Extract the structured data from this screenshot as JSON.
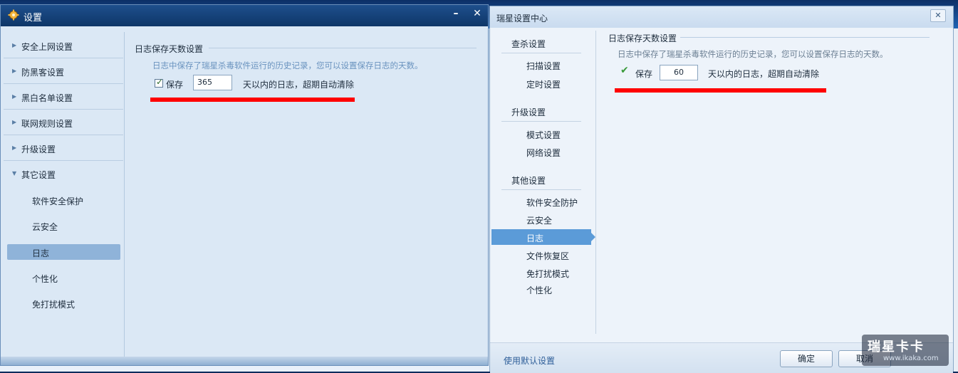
{
  "windowA": {
    "title": "设置",
    "minimize": "–",
    "close": "✕",
    "sidebar": {
      "sections": [
        {
          "label": "安全上网设置"
        },
        {
          "label": "防黑客设置"
        },
        {
          "label": "黑白名单设置"
        },
        {
          "label": "联网规则设置"
        },
        {
          "label": "升级设置"
        },
        {
          "label": "其它设置"
        }
      ],
      "subitems": [
        {
          "label": "软件安全保护"
        },
        {
          "label": "云安全"
        },
        {
          "label": "日志",
          "selected": true
        },
        {
          "label": "个性化"
        },
        {
          "label": "免打扰模式"
        }
      ]
    },
    "content": {
      "section_title": "日志保存天数设置",
      "description": "日志中保存了瑞星杀毒软件运行的历史记录，您可以设置保存日志的天数。",
      "save_label": "保存",
      "save_checked": true,
      "days_value": "365",
      "suffix": "天以内的日志，超期自动清除"
    }
  },
  "windowB": {
    "title": "瑞星设置中心",
    "close": "✕",
    "nav": {
      "group1": {
        "label": "查杀设置",
        "items": [
          {
            "label": "扫描设置"
          },
          {
            "label": "定时设置"
          }
        ]
      },
      "group2": {
        "label": "升级设置",
        "items": [
          {
            "label": "模式设置"
          },
          {
            "label": "网络设置"
          }
        ]
      },
      "group3": {
        "label": "其他设置",
        "items": [
          {
            "label": "软件安全防护"
          },
          {
            "label": "云安全"
          },
          {
            "label": "日志",
            "selected": true
          },
          {
            "label": "文件恢复区"
          },
          {
            "label": "免打扰模式"
          },
          {
            "label": "个性化"
          }
        ]
      }
    },
    "content": {
      "section_title": "日志保存天数设置",
      "description": "日志中保存了瑞星杀毒软件运行的历史记录，您可以设置保存日志的天数。",
      "save_label": "保存",
      "save_checked": true,
      "days_value": "60",
      "suffix": "天以内的日志，超期自动清除"
    },
    "footer": {
      "default_link": "使用默认设置",
      "ok_label": "确定",
      "cancel_label": "取消"
    }
  },
  "watermark": {
    "brand": "瑞星卡卡",
    "url": "www.ikaka.com"
  },
  "colors": {
    "accent_selected": "#5b9bd8",
    "underline_red": "#ff0000",
    "title_blue": "#0e3668"
  }
}
